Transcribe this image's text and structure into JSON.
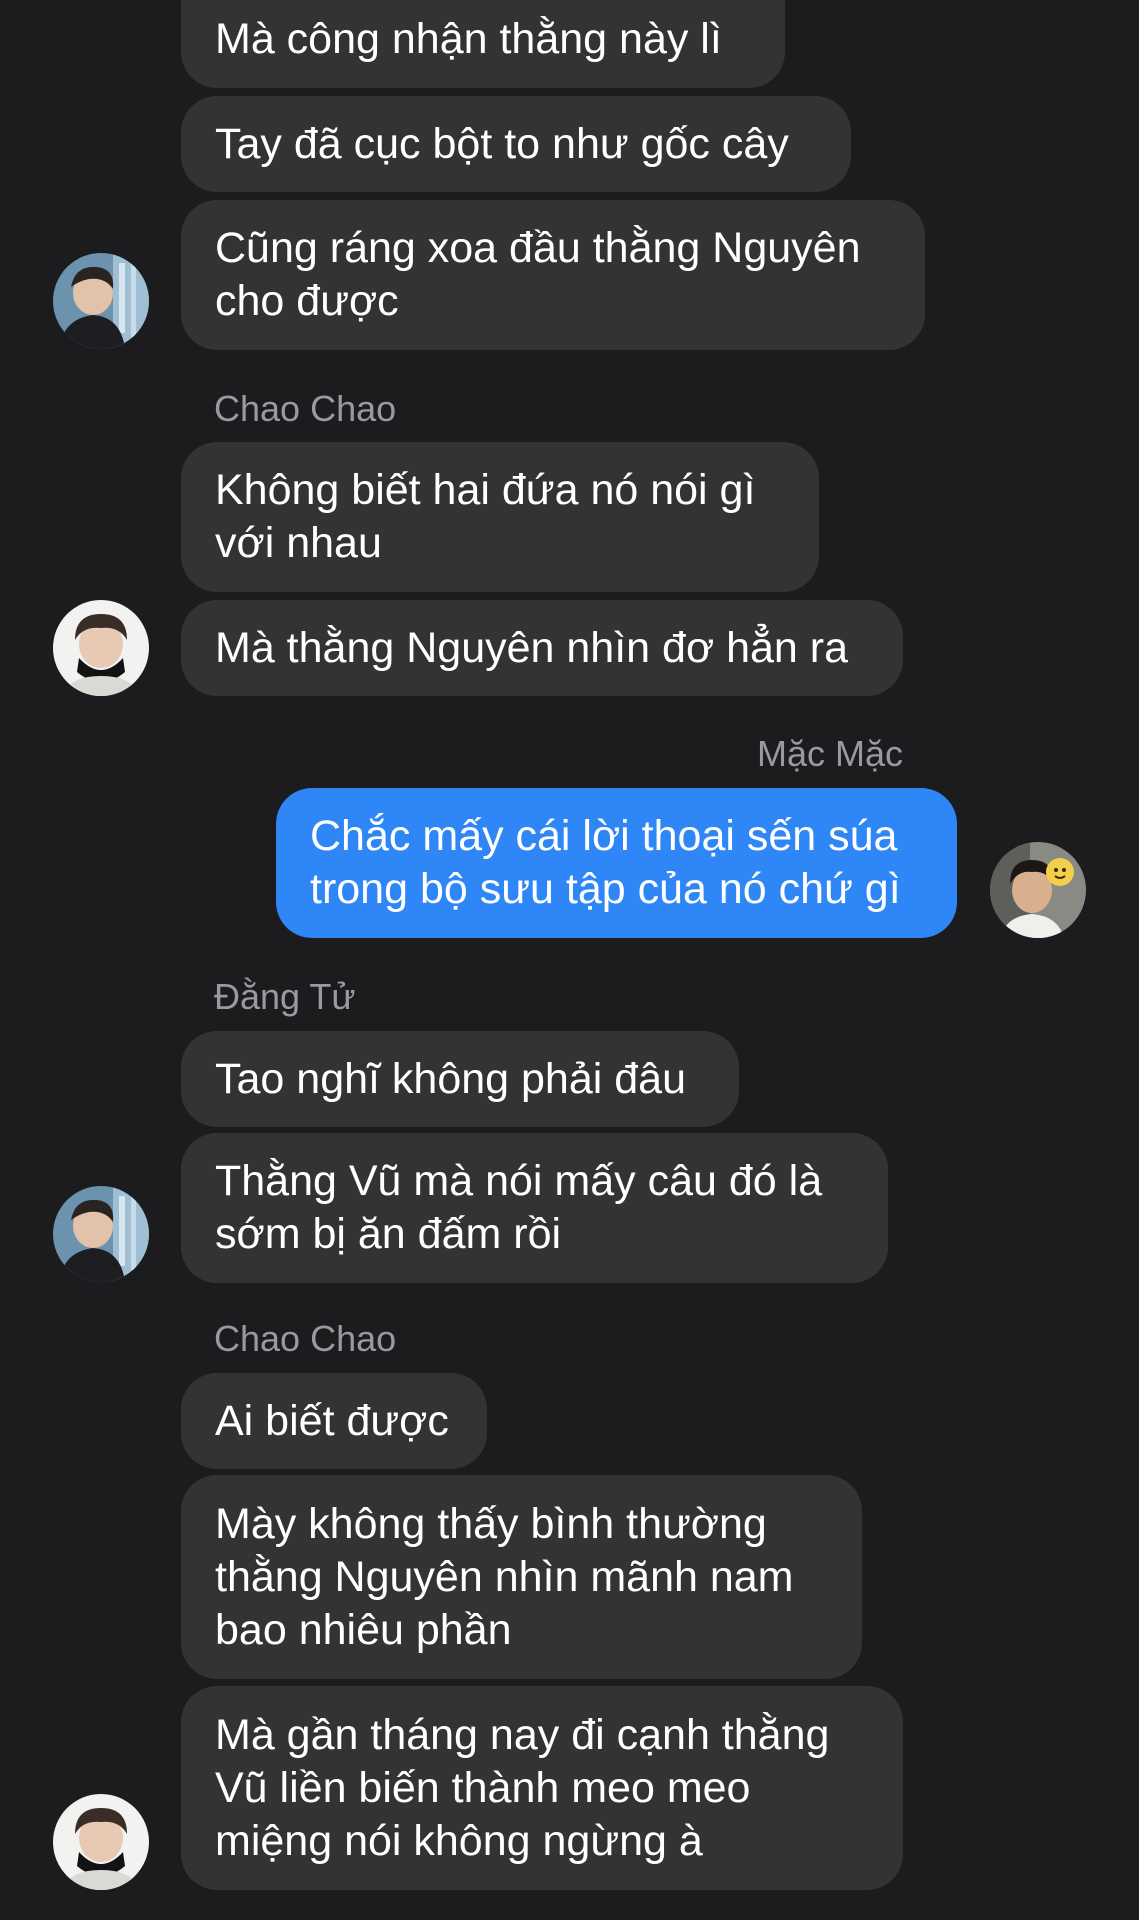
{
  "conversation": {
    "senders": {
      "chao": "Chao Chao",
      "mac": "Mặc Mặc",
      "dang": "Đằng Tử"
    },
    "messages": {
      "m1": {
        "lines": [
          "Mà công nhận thằng này lì"
        ]
      },
      "m2": {
        "lines": [
          "Tay đã cục bột to như gốc cây"
        ]
      },
      "m3": {
        "lines": [
          "Cũng ráng xoa đầu thằng Nguyên",
          "cho được"
        ]
      },
      "m4": {
        "lines": [
          "Không biết hai đứa nó nói gì",
          "với nhau"
        ]
      },
      "m5": {
        "lines": [
          "Mà thằng Nguyên nhìn đơ hẳn ra"
        ]
      },
      "m6": {
        "lines": [
          "Chắc mấy cái lời thoại sến súa",
          "trong bộ sưu tập của nó chứ gì"
        ]
      },
      "m7": {
        "lines": [
          "Tao nghĩ không phải đâu"
        ]
      },
      "m8": {
        "lines": [
          "Thằng Vũ mà nói mấy câu đó là",
          "sớm bị ăn đấm rồi"
        ]
      },
      "m9": {
        "lines": [
          "Ai biết được"
        ]
      },
      "m10": {
        "lines": [
          "Mày không thấy bình thường",
          "thằng Nguyên nhìn mãnh nam",
          "bao nhiêu phần"
        ]
      },
      "m11": {
        "lines": [
          "Mà gần tháng nay đi cạnh thằng",
          "Vũ liền biến thành meo meo",
          "miệng nói không ngừng à"
        ]
      }
    }
  },
  "colors": {
    "background": "#1c1c1e",
    "incoming_bubble": "#333335",
    "outgoing_bubble": "#2f86f6",
    "sender_name": "#9a9a9e"
  }
}
